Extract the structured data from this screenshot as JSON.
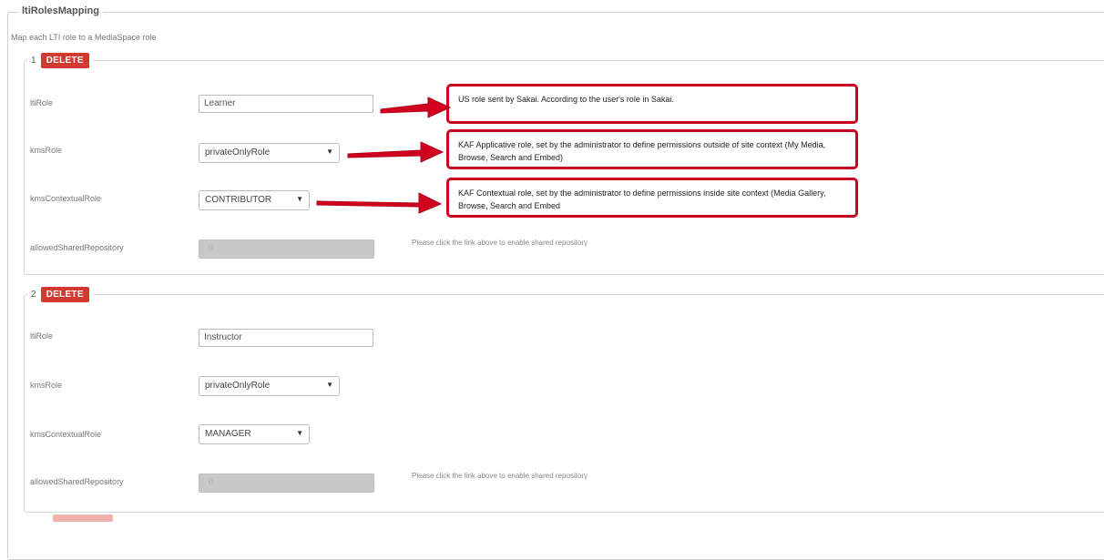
{
  "section_title": "ltiRolesMapping",
  "description": "Map each LTI role to a MediaSpace role",
  "delete_label": "DELETE",
  "groups": [
    {
      "index": "1",
      "rows": {
        "ltiRole_label": "ltiRole",
        "ltiRole_value": "Learner",
        "kmsRole_label": "kmsRole",
        "kmsRole_value": "privateOnlyRole",
        "kmsContextualRole_label": "kmsContextualRole",
        "kmsContextualRole_value": "CONTRIBUTOR",
        "allowedSharedRepository_label": "allowedSharedRepository",
        "allowedSharedRepository_value": "0",
        "shared_repo_note": "Please click the link above to enable shared repository"
      }
    },
    {
      "index": "2",
      "rows": {
        "ltiRole_label": "ltiRole",
        "ltiRole_value": "Instructor",
        "kmsRole_label": "kmsRole",
        "kmsRole_value": "privateOnlyRole",
        "kmsContextualRole_label": "kmsContextualRole",
        "kmsContextualRole_value": "MANAGER",
        "allowedSharedRepository_label": "allowedSharedRepository",
        "allowedSharedRepository_value": "0",
        "shared_repo_note": "Please click the link above to enable shared repository"
      }
    }
  ],
  "callouts": [
    "US role sent by Sakai. According to the user's role in Sakai.",
    "KAF Applicative role, set by the administrator to define permissions outside of site context (My Media, Browse, Search and Embed)",
    "KAF Contextual role, set by the administrator to define permissions inside site context (Media Gallery, Browse, Search and Embed"
  ],
  "colors": {
    "delete_button": "#d33a2f",
    "callout_border": "#c8001e",
    "arrow": "#d0001e"
  },
  "icons": {
    "select_caret": "dropdown-caret-icon",
    "arrow": "red-arrow-icon"
  }
}
